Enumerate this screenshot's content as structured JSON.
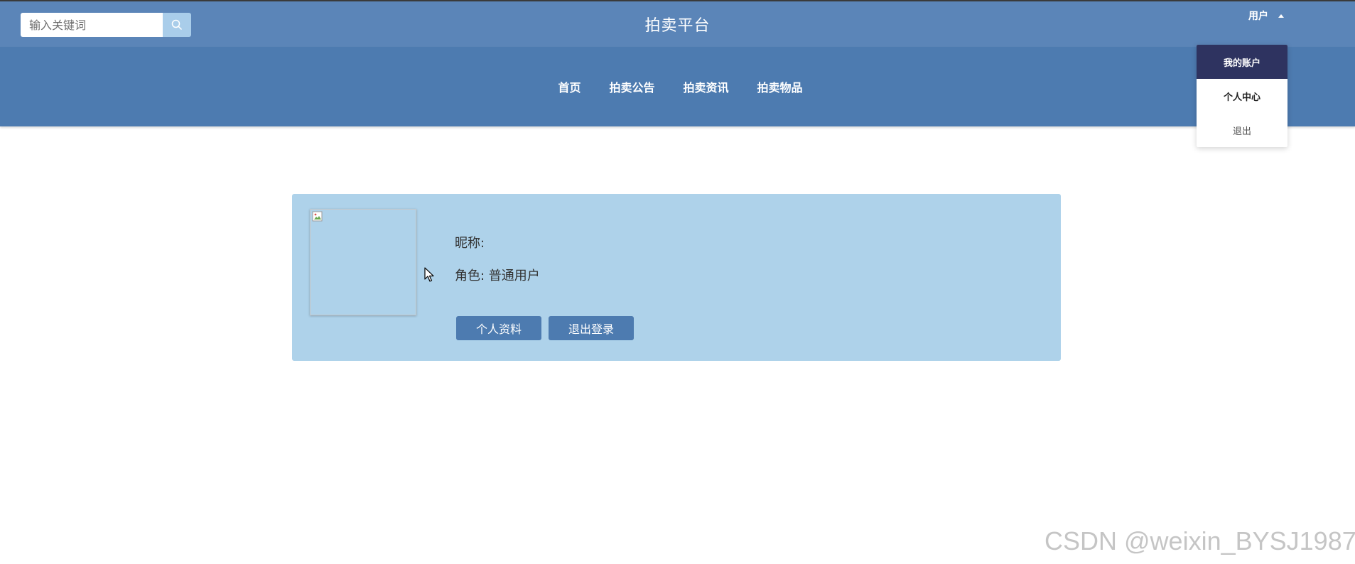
{
  "header": {
    "search": {
      "placeholder": "输入关键词",
      "value": ""
    },
    "title": "拍卖平台",
    "user_menu_label": "用户"
  },
  "nav": {
    "items": [
      {
        "label": "首页"
      },
      {
        "label": "拍卖公告"
      },
      {
        "label": "拍卖资讯"
      },
      {
        "label": "拍卖物品"
      }
    ]
  },
  "user_dropdown": {
    "items": [
      {
        "label": "我的账户",
        "active": true
      },
      {
        "label": "个人中心"
      },
      {
        "label": "退出"
      }
    ]
  },
  "profile": {
    "nickname_line": "昵称:",
    "role_line": "角色: 普通用户",
    "buttons": {
      "profile": "个人资料",
      "logout": "退出登录"
    }
  },
  "watermark": "CSDN @weixin_BYSJ1987",
  "colors": {
    "topbar": "#5b85b8",
    "navbar": "#4d7bb0",
    "card": "#aed2ea",
    "dropdown_active": "#2e3360",
    "button": "#4d7bb0"
  }
}
